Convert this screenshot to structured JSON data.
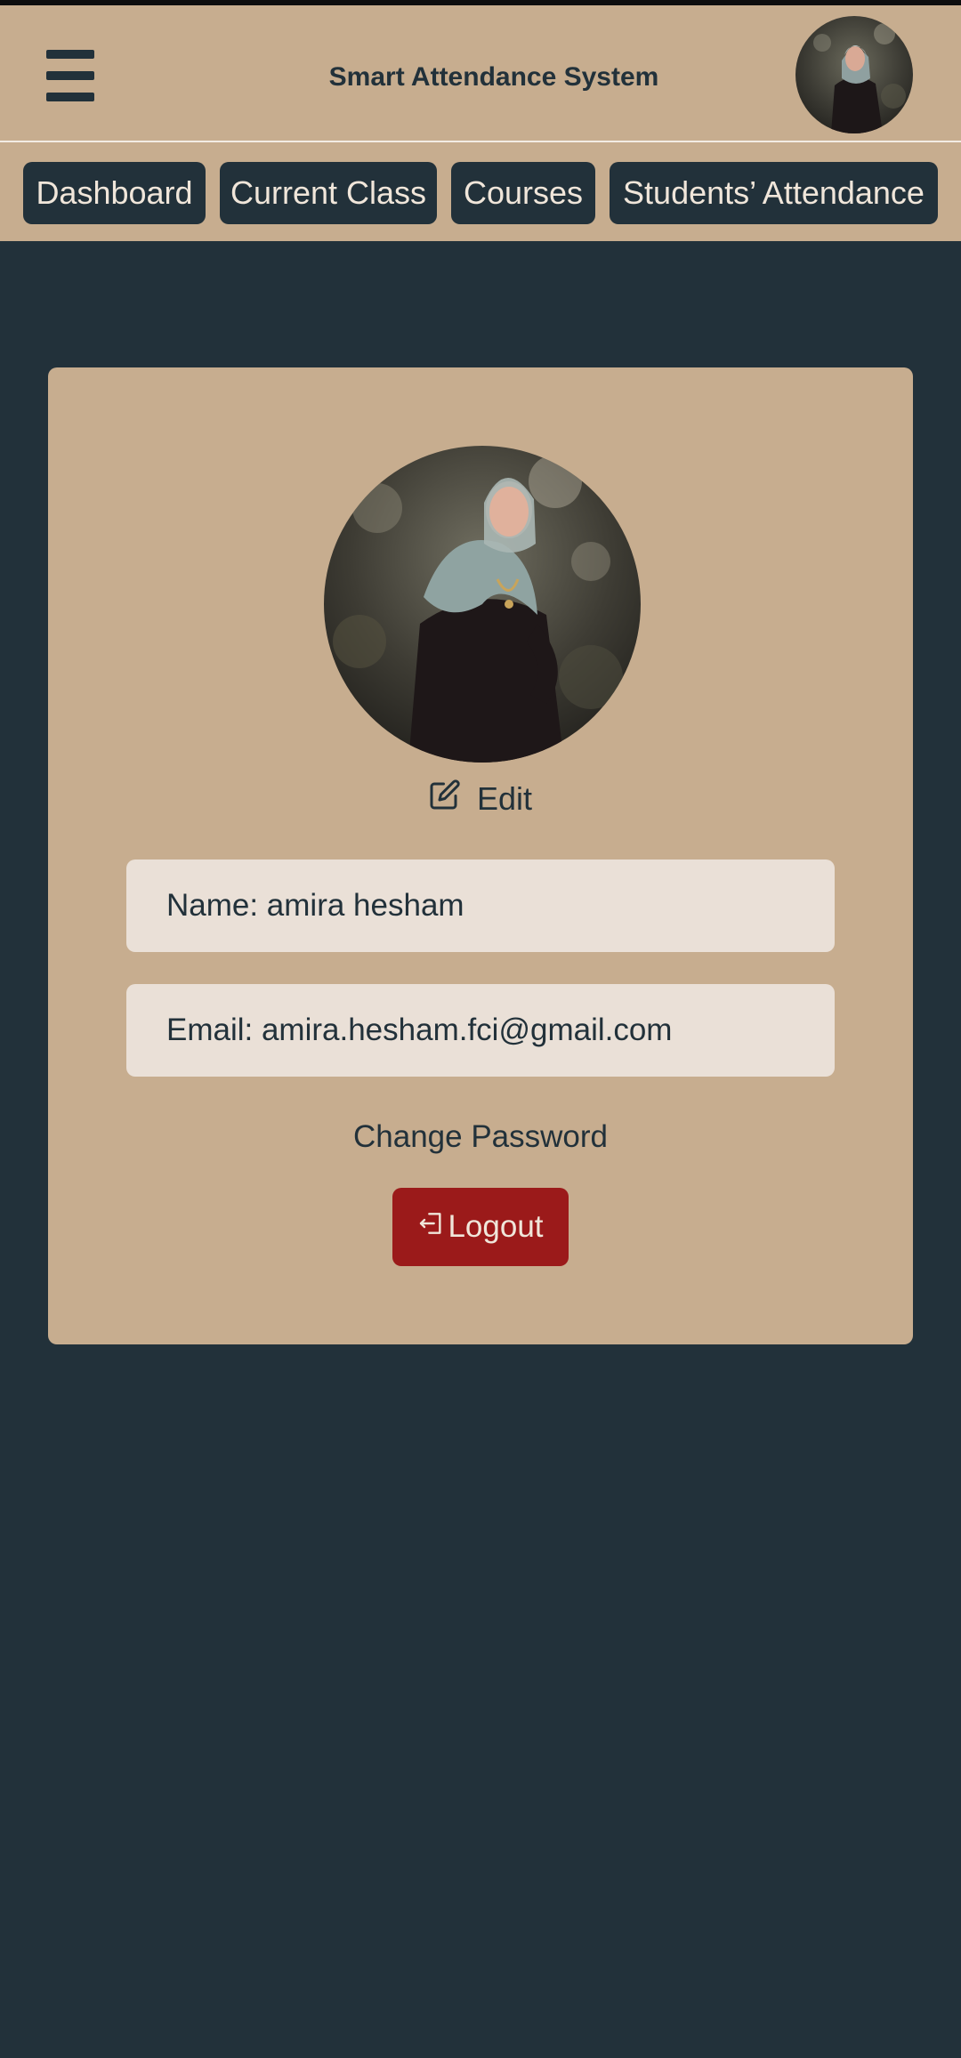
{
  "header": {
    "title": "Smart Attendance System",
    "menu_icon": "hamburger-menu-icon",
    "avatar": "profile-photo"
  },
  "nav": {
    "items": [
      "Dashboard",
      "Current Class",
      "Courses",
      "Students’ Attendance"
    ]
  },
  "profile": {
    "edit_label": "Edit",
    "edit_icon": "pencil-square-icon",
    "name_text": "Name: amira hesham",
    "email_text": "Email: amira.hesham.fci@gmail.com",
    "change_password_label": "Change Password",
    "logout_label": "Logout",
    "logout_icon": "logout-arrow-icon"
  },
  "colors": {
    "background": "#22313a",
    "panel": "#c7ad8f",
    "field": "#eae0d7",
    "logout": "#9b1a1a",
    "text_dark": "#22313a",
    "text_light": "#f0e6da"
  }
}
